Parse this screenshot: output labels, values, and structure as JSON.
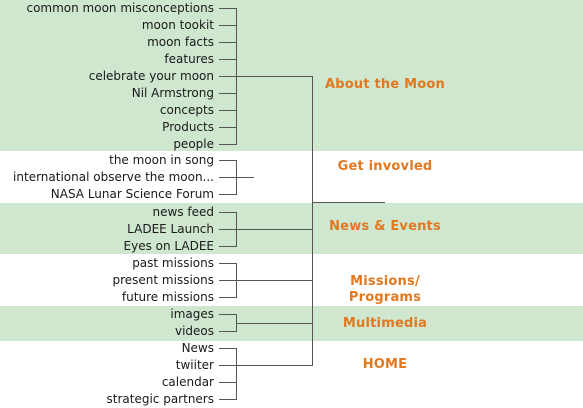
{
  "sections": [
    {
      "category": "About the Moon",
      "items": [
        "common moon misconceptions",
        "moon tookit",
        "moon facts",
        "features",
        "celebrate your moon",
        "Nil Armstrong",
        "concepts",
        "Products",
        "people"
      ]
    },
    {
      "category": "Get invovled",
      "items": [
        "the moon in song",
        "international observe the moon...",
        "NASA Lunar Science Forum"
      ]
    },
    {
      "category": "News & Events",
      "items": [
        "news feed",
        "LADEE Launch",
        "Eyes on LADEE"
      ]
    },
    {
      "category": "Missions/ Programs",
      "items": [
        "past missions",
        "present missions",
        "future missions"
      ]
    },
    {
      "category": "Multimedia",
      "items": [
        "images",
        "videos"
      ]
    },
    {
      "category": "HOME",
      "items": [
        "News",
        "twiiter",
        "calendar",
        "strategic partners"
      ]
    }
  ],
  "colors": {
    "green_band": "#cfe6cf",
    "category_text": "#e2781f",
    "line": "#555555"
  }
}
